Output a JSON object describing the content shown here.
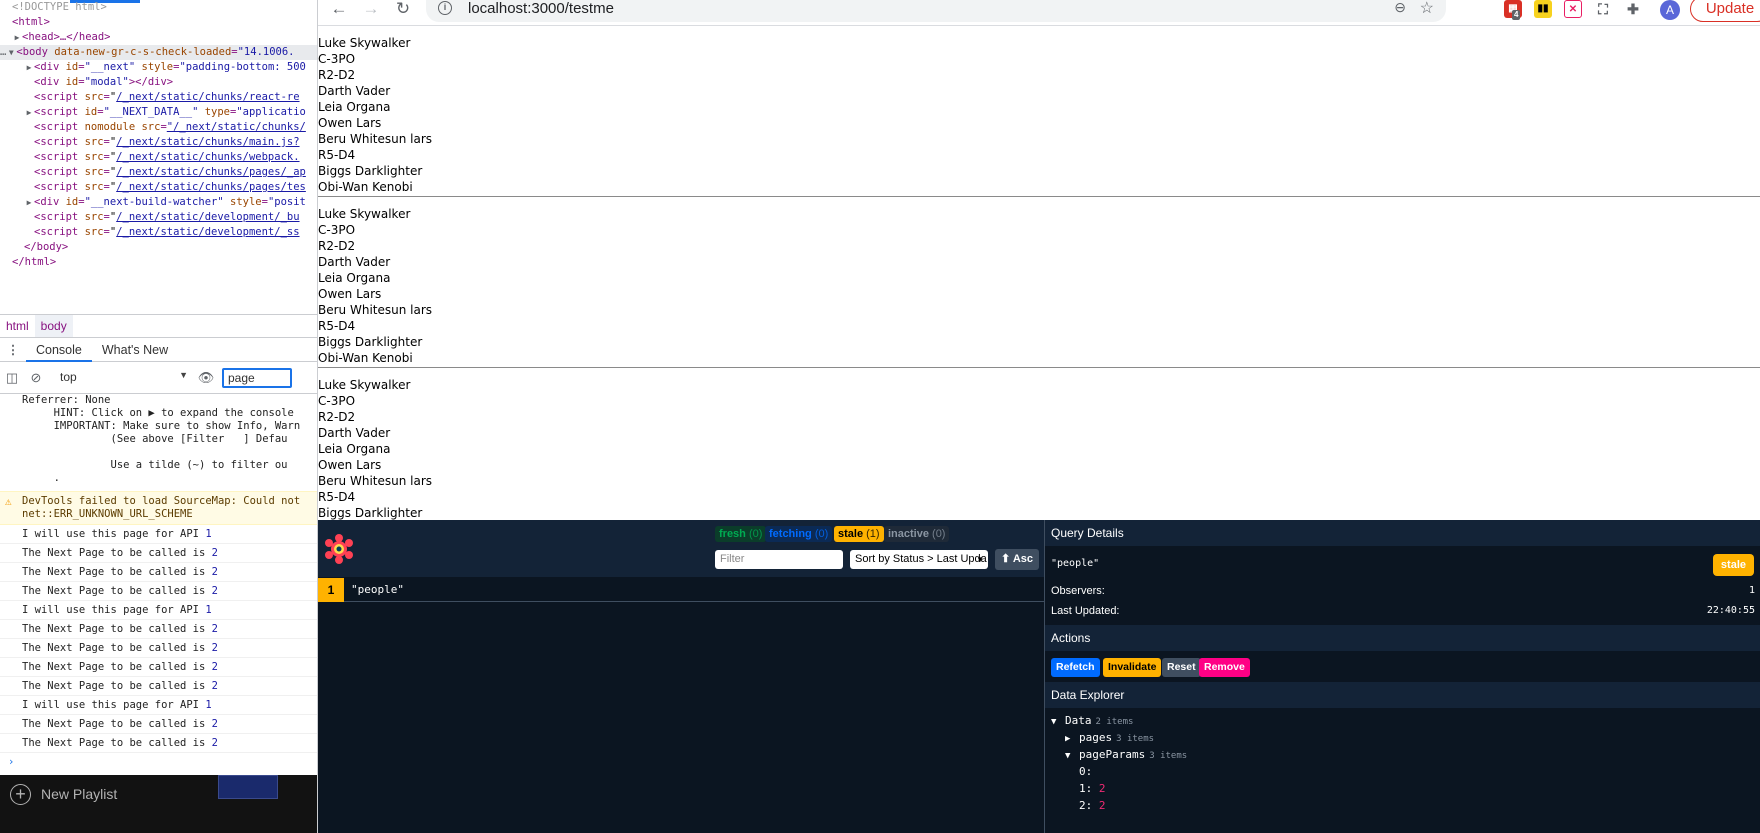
{
  "devtools": {
    "elements": {
      "doctype": "<!DOCTYPE html>",
      "html_open": "<html>",
      "head": "<head>…</head>",
      "body_attr_name": "data-new-gr-c-s-check-loaded",
      "body_attr_value": "\"14.1006.",
      "next_div_id": "\"__next\"",
      "next_div_style": "\"padding-bottom: 500",
      "modal_div": "\"modal\"",
      "scripts": [
        "/_next/static/chunks/react-re",
        "/_next/static/chunks/",
        "/_next/static/chunks/main.js?",
        "/_next/static/chunks/webpack.",
        "/_next/static/chunks/pages/_ap",
        "/_next/static/chunks/pages/tes"
      ],
      "next_data_id": "\"__NEXT_DATA__\"",
      "next_data_type": "\"applicatio",
      "nomodule_src": "\"/_next/static/chunks/",
      "build_watcher_id": "\"__next-build-watcher\"",
      "build_watcher_style": "\"posit",
      "dev_scripts": [
        "/_next/static/development/_bu",
        "/_next/static/development/_ss"
      ],
      "body_close": "</body>",
      "html_close": "</html>"
    },
    "breadcrumbs": [
      "html",
      "body"
    ],
    "drawer_tabs": [
      "Console",
      "What's New"
    ],
    "context_select": "top",
    "filter_value": "page",
    "console_pre": [
      "Referrer: None",
      "     HINT: Click on ▶ to expand the console",
      "     IMPORTANT: Make sure to show Info, Warn",
      "              (See above [Filter   ] Defau",
      "",
      "              Use a tilde (~) to filter ou",
      "     ."
    ],
    "warning": {
      "line1": "DevTools failed to load SourceMap: Could not",
      "line2": "net::ERR_UNKNOWN_URL_SCHEME"
    },
    "log_lines": [
      {
        "text": "I will use this page for API",
        "num": "1"
      },
      {
        "text": "The Next Page to be called is",
        "num": "2"
      },
      {
        "text": "The Next Page to be called is",
        "num": "2"
      },
      {
        "text": "The Next Page to be called is",
        "num": "2"
      },
      {
        "text": "I will use this page for API",
        "num": "1"
      },
      {
        "text": "The Next Page to be called is",
        "num": "2"
      },
      {
        "text": "The Next Page to be called is",
        "num": "2"
      },
      {
        "text": "The Next Page to be called is",
        "num": "2"
      },
      {
        "text": "The Next Page to be called is",
        "num": "2"
      },
      {
        "text": "I will use this page for API",
        "num": "1"
      },
      {
        "text": "The Next Page to be called is",
        "num": "2"
      },
      {
        "text": "The Next Page to be called is",
        "num": "2"
      }
    ],
    "prompt": "›"
  },
  "taskbar": {
    "new_playlist": "New Playlist"
  },
  "browser": {
    "url": "localhost:3000/testme",
    "update_label": "Update",
    "avatar_letter": "A",
    "ext_badge": "4"
  },
  "page": {
    "blocks": [
      [
        "Luke Skywalker",
        "C-3PO",
        "R2-D2",
        "Darth Vader",
        "Leia Organa",
        "Owen Lars",
        "Beru Whitesun lars",
        "R5-D4",
        "Biggs Darklighter",
        "Obi-Wan Kenobi"
      ],
      [
        "Luke Skywalker",
        "C-3PO",
        "R2-D2",
        "Darth Vader",
        "Leia Organa",
        "Owen Lars",
        "Beru Whitesun lars",
        "R5-D4",
        "Biggs Darklighter",
        "Obi-Wan Kenobi"
      ],
      [
        "Luke Skywalker",
        "C-3PO",
        "R2-D2",
        "Darth Vader",
        "Leia Organa",
        "Owen Lars",
        "Beru Whitesun lars",
        "R5-D4",
        "Biggs Darklighter"
      ]
    ]
  },
  "react_query": {
    "counts": {
      "fresh": {
        "label": "fresh",
        "n": "(0)"
      },
      "fetching": {
        "label": "fetching",
        "n": "(0)"
      },
      "stale": {
        "label": "stale",
        "n": "(1)"
      },
      "inactive": {
        "label": "inactive",
        "n": "(0)"
      }
    },
    "filter_placeholder": "Filter",
    "sort_value": "Sort by Status > Last Upda",
    "asc_label": "⬆ Asc",
    "query_row": {
      "observers": "1",
      "key": "\"people\""
    },
    "details": {
      "title": "Query Details",
      "query_hash": "\"people\"",
      "status_badge": "stale",
      "observers_label": "Observers:",
      "observers_value": "1",
      "last_updated_label": "Last Updated:",
      "last_updated_value": "22:40:55",
      "actions_title": "Actions",
      "actions": [
        "Refetch",
        "Invalidate",
        "Reset",
        "Remove"
      ],
      "explorer_title": "Data Explorer",
      "explorer": {
        "data_label": "Data",
        "data_info": "2 items",
        "pages_label": "pages",
        "pages_info": "3 items",
        "pageparams_label": "pageParams",
        "pageparams_info": "3 items",
        "params": [
          {
            "key": "0:",
            "value": ""
          },
          {
            "key": "1:",
            "value": "2"
          },
          {
            "key": "2:",
            "value": "2"
          }
        ]
      }
    },
    "colors": {
      "fresh": "#00ab52",
      "fetching": "#006bff",
      "stale": "#ffb200",
      "inactive": "#3f4e60",
      "refetch": "#006bff",
      "invalidate": "#ffb200",
      "reset": "#3f4e60",
      "remove": "#ff0085"
    }
  }
}
